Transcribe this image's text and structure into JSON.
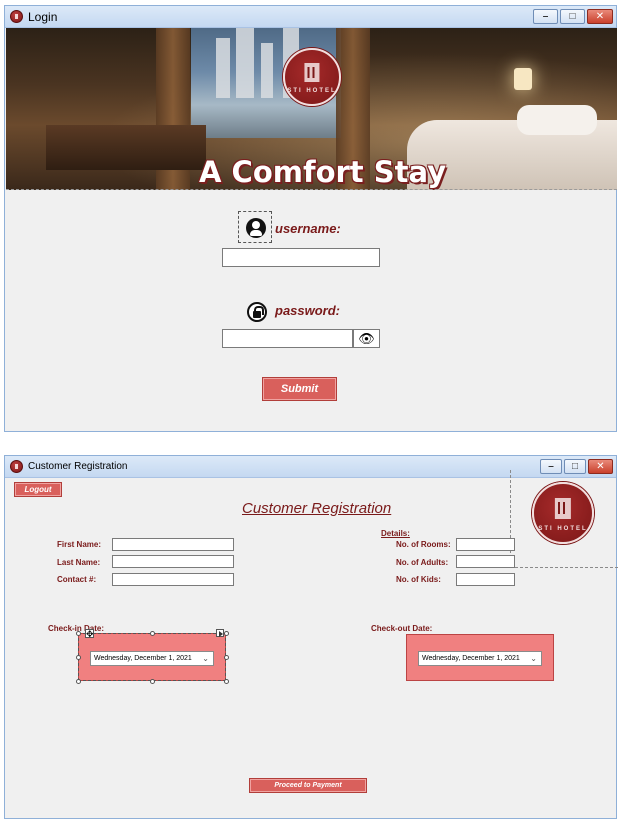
{
  "login_window": {
    "title": "Login",
    "banner": {
      "slogan": "A Comfort Stay",
      "logo_text": "STI HOTEL"
    },
    "username_label": "username:",
    "username_value": "",
    "password_label": "password:",
    "password_value": "",
    "submit_label": "Submit",
    "icons": {
      "user": "user-circle-icon",
      "lock": "lock-icon",
      "eye": "eye-icon"
    },
    "accent_color": "#d9605c",
    "label_color": "#7a1a1a"
  },
  "registration_window": {
    "title": "Customer Registration",
    "logout_label": "Logout",
    "heading": "Customer Registration",
    "logo_text": "STI HOTEL",
    "fields": {
      "first_name_label": "First Name:",
      "last_name_label": "Last Name:",
      "contact_label": "Contact #:"
    },
    "details": {
      "title": "Details:",
      "rooms_label": "No. of Rooms:",
      "adults_label": "No. of Adults:",
      "kids_label": "No. of Kids:"
    },
    "checkin_label": "Check-in Date:",
    "checkin_value": "Wednesday, December   1, 2021",
    "checkout_label": "Check-out Date:",
    "checkout_value": "Wednesday, December   1, 2021",
    "proceed_label": "Proceed to Payment",
    "panel_color": "#f08080"
  }
}
